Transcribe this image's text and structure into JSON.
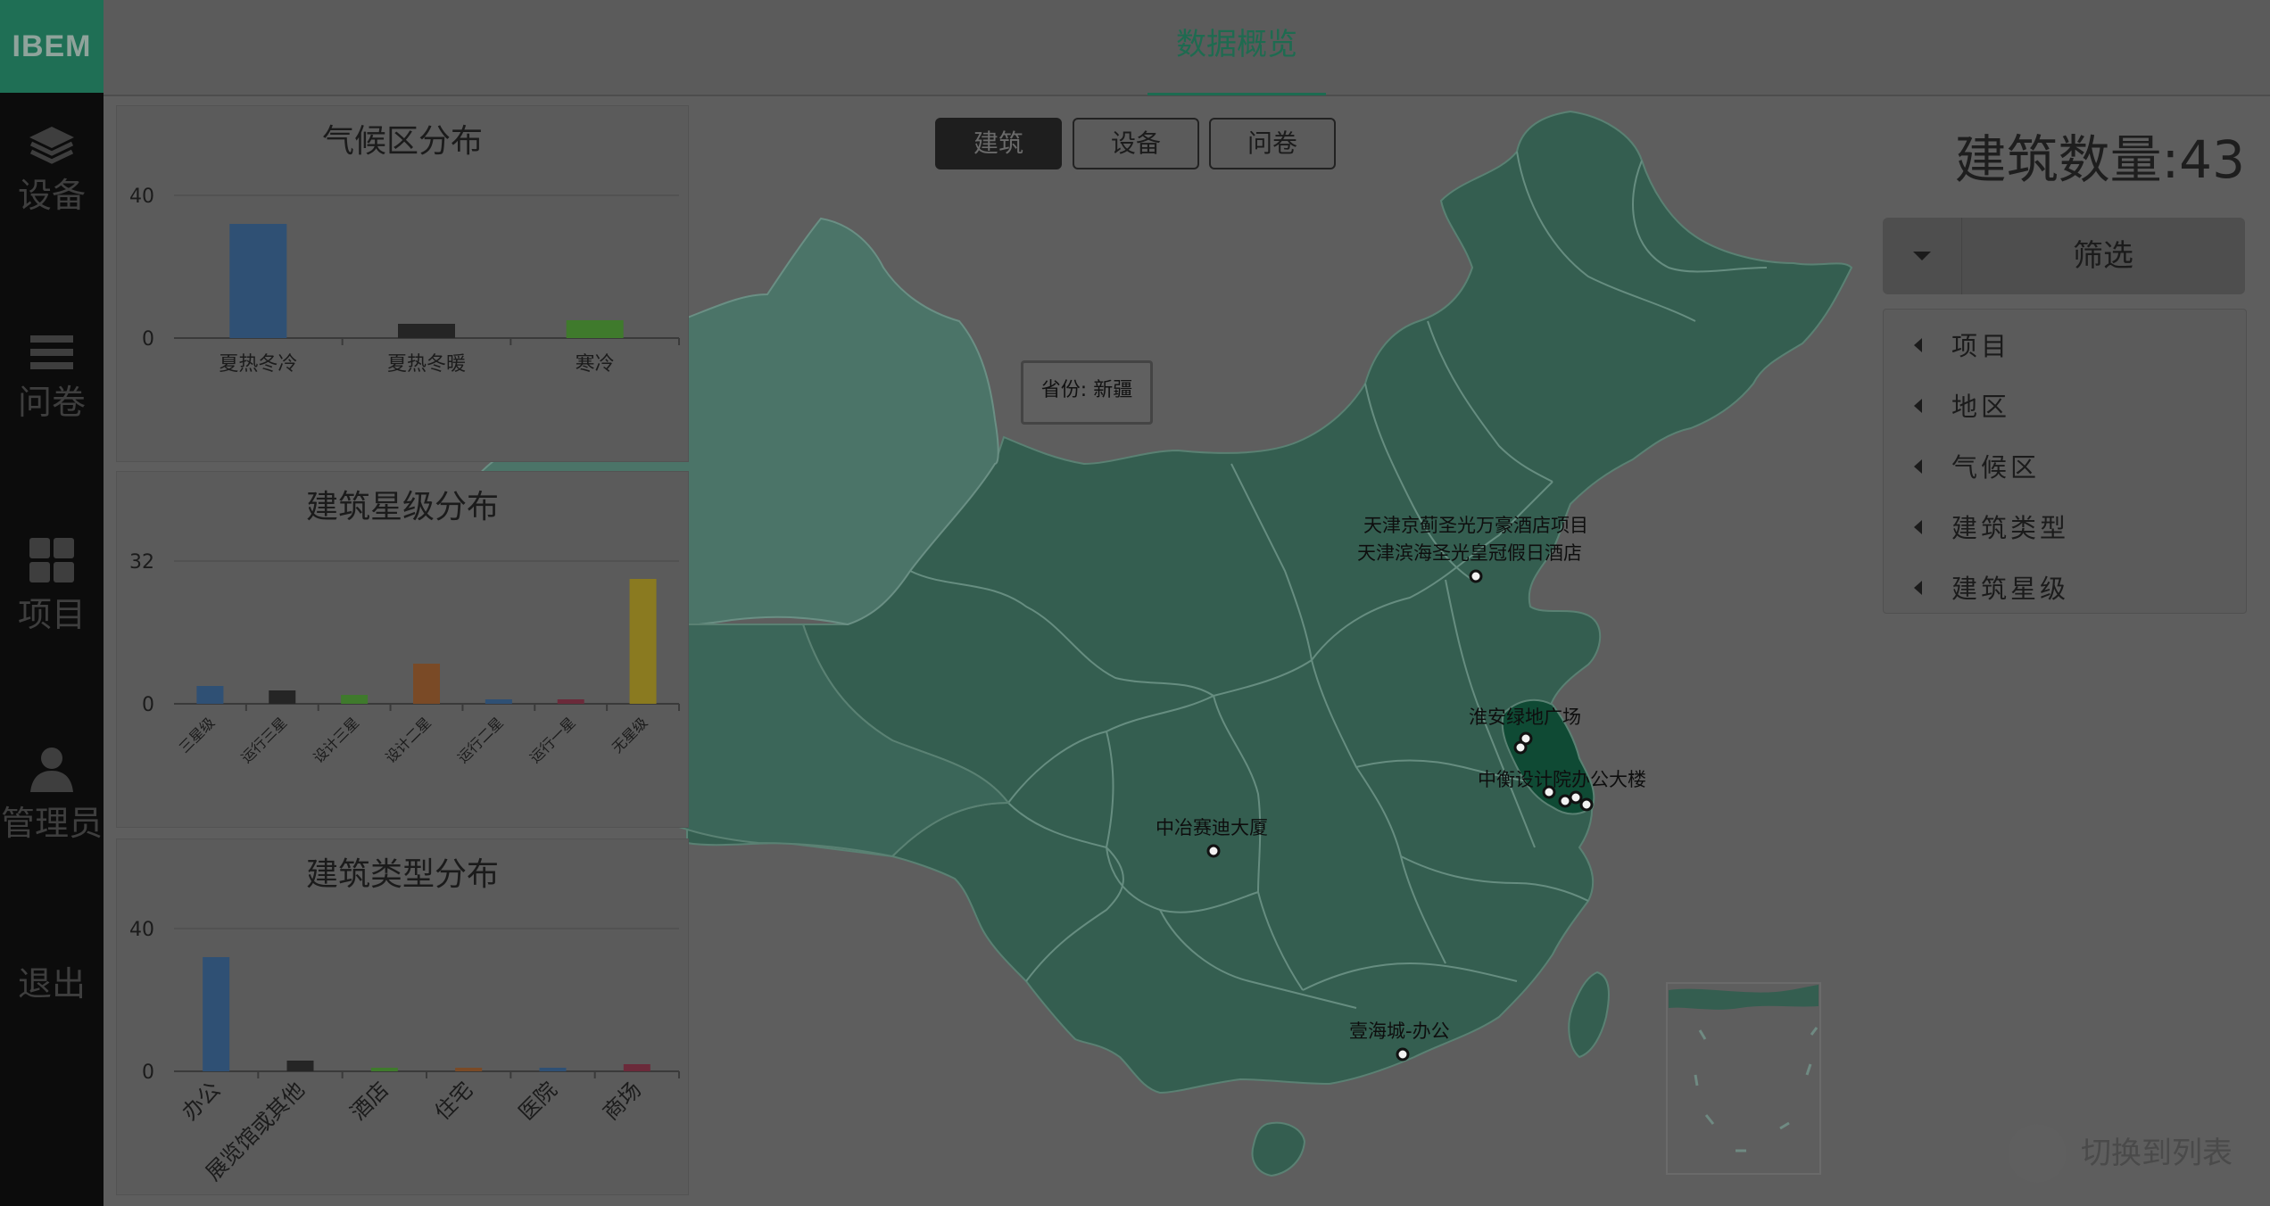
{
  "app": {
    "logo": "IBEM"
  },
  "sidebar": {
    "items": [
      {
        "label": "设备",
        "icon": "layers-icon"
      },
      {
        "label": "问卷",
        "icon": "list-icon"
      },
      {
        "label": "项目",
        "icon": "grid-icon"
      },
      {
        "label": "管理员",
        "icon": "user-icon"
      },
      {
        "label": "退出",
        "icon": ""
      }
    ]
  },
  "header": {
    "tab": "数据概览"
  },
  "map_tabs": [
    "建筑",
    "设备",
    "问卷"
  ],
  "active_tab": "建筑",
  "building_count": "建筑数量:43",
  "tooltip": "省份: 新疆",
  "filter": {
    "label": "筛选",
    "items": [
      "项目",
      "地区",
      "气候区",
      "建筑类型",
      "建筑星级"
    ]
  },
  "switch_label": "切换到列表",
  "map_markers": [
    {
      "name": "天津京蓟圣光万豪酒店项目"
    },
    {
      "name": "天津滨海圣光皇冠假日酒店"
    },
    {
      "name": "淮安绿地广场"
    },
    {
      "name": "中衡设计院办公大楼"
    },
    {
      "name": "中冶赛迪大厦"
    },
    {
      "name": "壹海城-办公"
    }
  ],
  "colors": {
    "map_fill": "#345e50",
    "highlight_fill": "#0f4a34",
    "xinjiang_fill": "#4b7468",
    "accent": "#1e6b50"
  },
  "chart_data": [
    {
      "type": "bar",
      "title": "气候区分布",
      "categories": [
        "夏热冬冷",
        "夏热冬暖",
        "寒冷"
      ],
      "values": [
        32,
        4,
        5
      ],
      "colors": [
        "#2f5074",
        "#252525",
        "#3f7a2c"
      ],
      "yticks": [
        0,
        40
      ],
      "ylim": [
        0,
        40
      ]
    },
    {
      "type": "bar",
      "title": "建筑星级分布",
      "categories": [
        "三星级",
        "运行三星",
        "设计三星",
        "设计二星",
        "运行二星",
        "运行一星",
        "无星级"
      ],
      "values": [
        4,
        3,
        2,
        9,
        1,
        1,
        28
      ],
      "colors": [
        "#2f5074",
        "#252525",
        "#3f7a2c",
        "#7a4a26",
        "#2f5074",
        "#6b2a3a",
        "#8a7a20"
      ],
      "yticks": [
        0,
        32
      ],
      "ylim": [
        0,
        32
      ]
    },
    {
      "type": "bar",
      "title": "建筑类型分布",
      "categories": [
        "办公",
        "展览馆或其他",
        "酒店",
        "住宅",
        "医院",
        "商场"
      ],
      "values": [
        32,
        3,
        1,
        1,
        1,
        2
      ],
      "colors": [
        "#2f5074",
        "#252525",
        "#3f7a2c",
        "#7a4a26",
        "#2f5074",
        "#6b2a3a"
      ],
      "yticks": [
        0,
        40
      ],
      "ylim": [
        0,
        40
      ]
    }
  ]
}
